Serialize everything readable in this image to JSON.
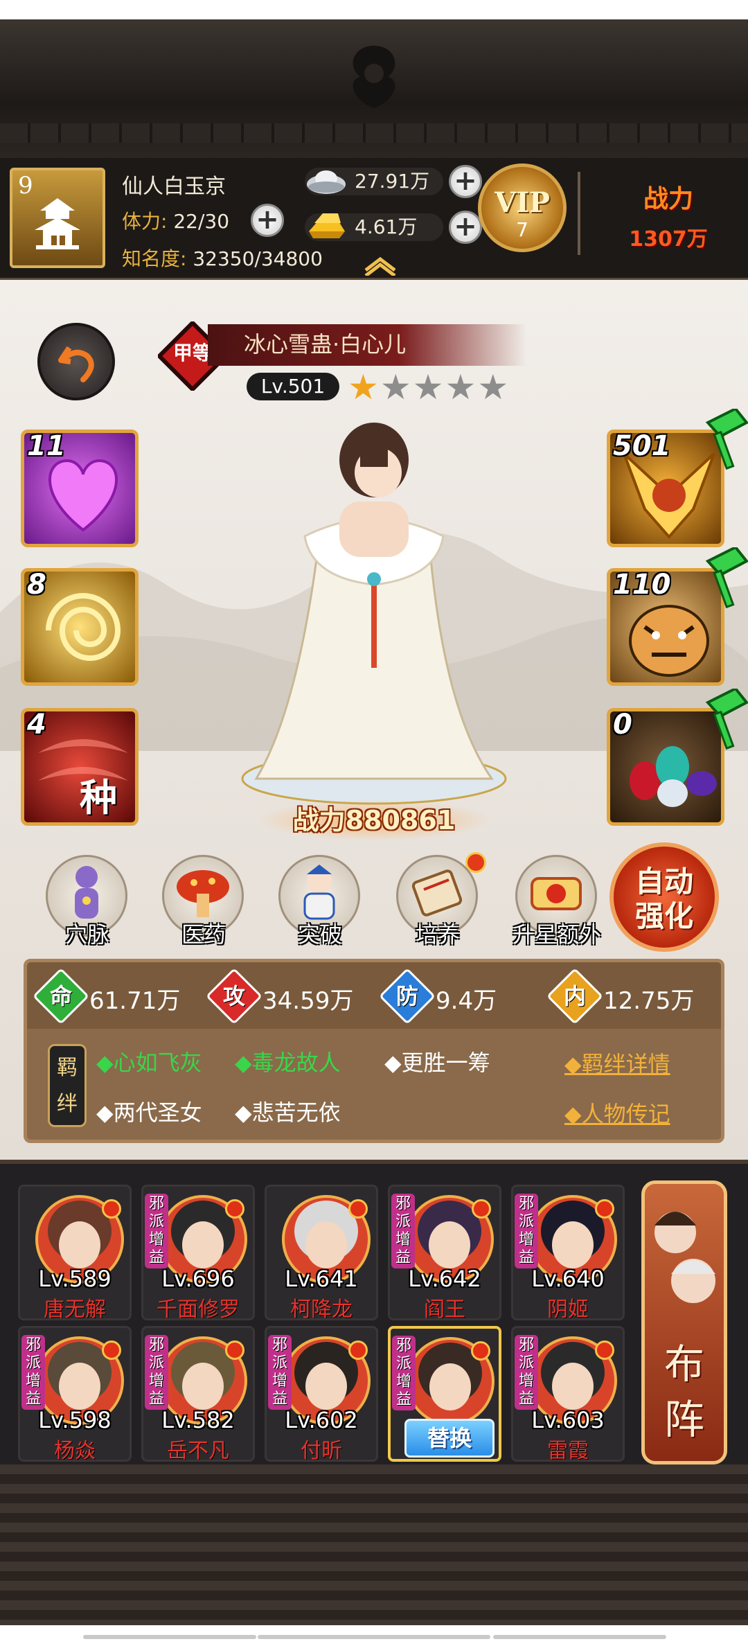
{
  "player": {
    "level": "9",
    "name": "仙人白玉京",
    "stamina_label": "体力:",
    "stamina_value": "22/30",
    "fame_label": "知名度:",
    "fame_value": "32350/34800"
  },
  "resources": {
    "silver": "27.91万",
    "gold": "4.61万"
  },
  "vip": {
    "label": "VIP",
    "level": "7"
  },
  "top_power": {
    "label": "战力",
    "value": "1307万"
  },
  "hero": {
    "grade": "甲等",
    "name": "冰心雪蛊·白心儿",
    "level": "Lv.501",
    "stars_filled": 1,
    "stars_total": 5,
    "power": "战力880861"
  },
  "left_skills": [
    {
      "count": "11",
      "icon": "heart-skill-icon"
    },
    {
      "count": "8",
      "icon": "vortex-skill-icon"
    },
    {
      "count": "4",
      "icon": "seed-skill-icon",
      "glyph": "种"
    }
  ],
  "right_equips": [
    {
      "count": "501",
      "icon": "golden-beast-icon"
    },
    {
      "count": "110",
      "icon": "tiger-icon"
    },
    {
      "count": "0",
      "icon": "gems-icon"
    }
  ],
  "functions": [
    {
      "label": "穴脉",
      "icon": "meridian-icon",
      "dot": false
    },
    {
      "label": "医药",
      "icon": "mushroom-icon",
      "dot": false
    },
    {
      "label": "突破",
      "icon": "breakthrough-icon",
      "dot": false
    },
    {
      "label": "培养",
      "icon": "scroll-icon",
      "dot": true
    },
    {
      "label": "升星额外",
      "icon": "star-up-icon",
      "dot": false
    }
  ],
  "auto_strengthen": "自动强化",
  "stats": [
    {
      "key": "命",
      "value": "61.71万",
      "color": "#2fae3a"
    },
    {
      "key": "攻",
      "value": "34.59万",
      "color": "#d92a2a"
    },
    {
      "key": "防",
      "value": "9.4万",
      "color": "#2a7ed9"
    },
    {
      "key": "内",
      "value": "12.75万",
      "color": "#e8a21e"
    }
  ],
  "bonds": {
    "tag": "羁绊",
    "items": [
      {
        "text": "◆心如飞灰",
        "active": true
      },
      {
        "text": "◆毒龙故人",
        "active": true
      },
      {
        "text": "◆更胜一筹",
        "active": false
      },
      {
        "text": "◆两代圣女",
        "active": false
      },
      {
        "text": "◆悲苦无依",
        "active": false
      }
    ],
    "detail_link": "◆羁绊详情",
    "bio_link": "◆人物传记"
  },
  "lineup": [
    {
      "level": "Lv.589",
      "name": "唐无解",
      "tag": ""
    },
    {
      "level": "Lv.696",
      "name": "千面修罗",
      "tag": "邪派增益"
    },
    {
      "level": "Lv.641",
      "name": "柯降龙",
      "tag": ""
    },
    {
      "level": "Lv.642",
      "name": "阎王",
      "tag": "邪派增益"
    },
    {
      "level": "Lv.640",
      "name": "阴姬",
      "tag": "邪派增益"
    },
    {
      "level": "Lv.598",
      "name": "杨焱",
      "tag": "邪派增益"
    },
    {
      "level": "Lv.582",
      "name": "岳不凡",
      "tag": "邪派增益"
    },
    {
      "level": "Lv.602",
      "name": "付昕",
      "tag": "邪派增益"
    },
    {
      "level": "",
      "name": "",
      "tag": "邪派增益",
      "replace": "替换"
    },
    {
      "level": "Lv.603",
      "name": "雷霞",
      "tag": "邪派增益"
    }
  ],
  "formation_label": "布阵"
}
